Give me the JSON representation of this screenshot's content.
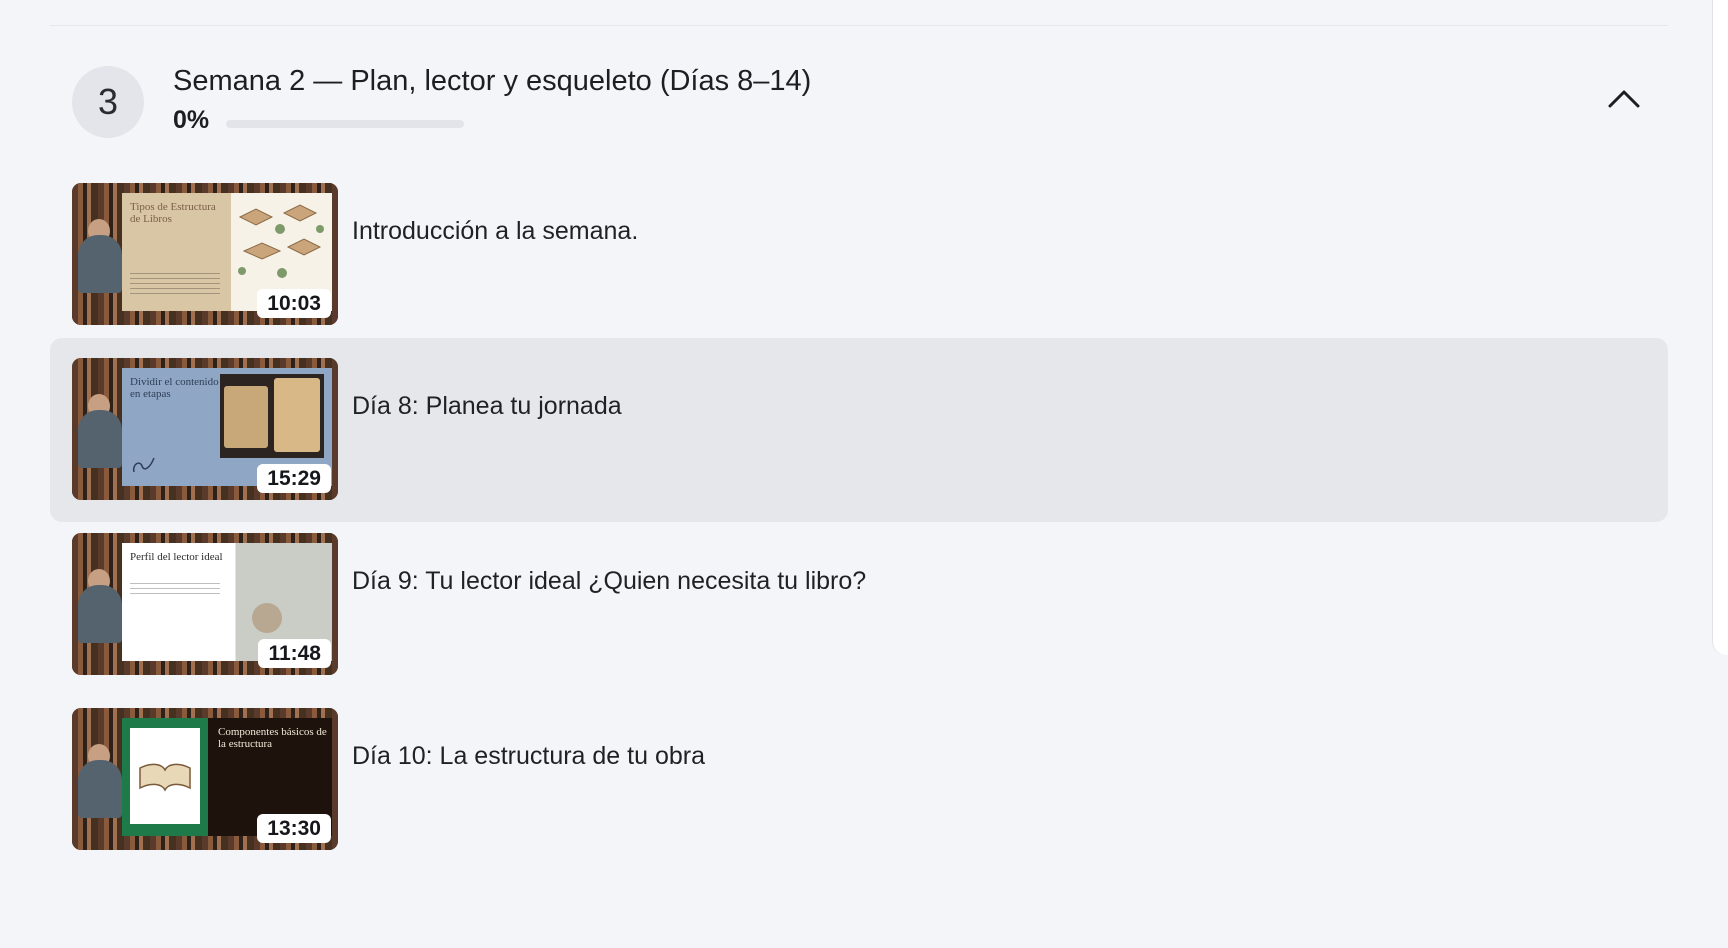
{
  "section": {
    "number": "3",
    "title": "Semana 2 — Plan, lector y esqueleto (Días 8–14)",
    "progress_label": "0%",
    "progress_value": 0,
    "toggle_icon": "chevron-up-icon"
  },
  "lessons": [
    {
      "title": "Introducción a la semana.",
      "duration": "10:03",
      "slide_text": "Tipos de Estructura de Libros",
      "active": false
    },
    {
      "title": "Día 8: Planea tu jornada",
      "duration": "15:29",
      "slide_text": "Dividir el contenido en etapas",
      "active": true
    },
    {
      "title": "Día 9: Tu lector ideal ¿Quien necesita tu libro?",
      "duration": "11:48",
      "slide_text": "Perfil del lector ideal",
      "active": false
    },
    {
      "title": "Día 10: La estructura de tu obra",
      "duration": "13:30",
      "slide_text": "Componentes básicos de la estructura",
      "active": false
    }
  ],
  "colors": {
    "background": "#f4f5f8",
    "active_row": "#e6e7eb",
    "number_circle": "#e4e5ea"
  }
}
